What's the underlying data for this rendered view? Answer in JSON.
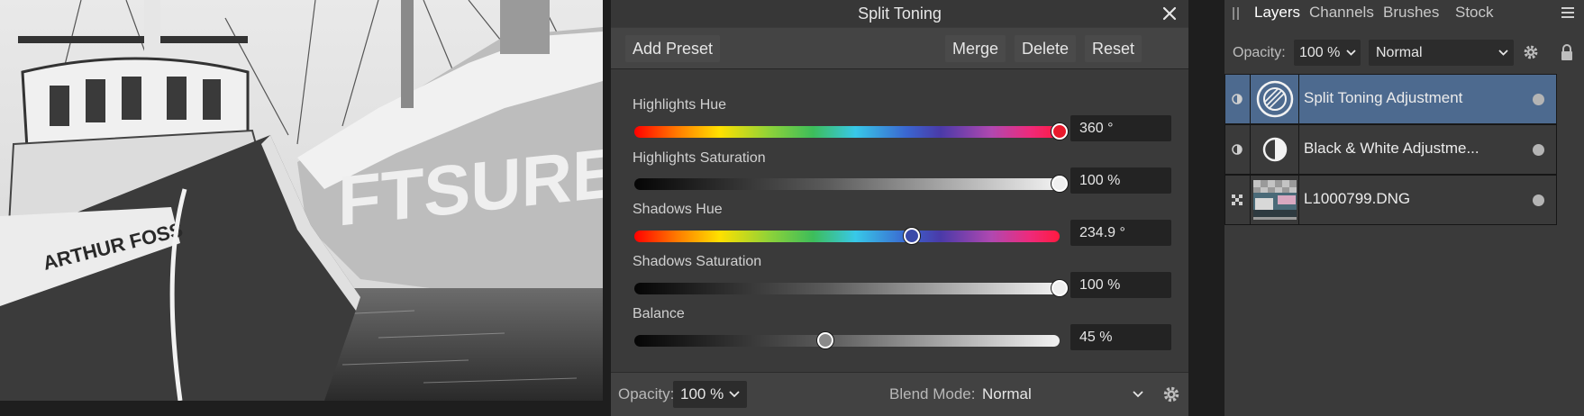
{
  "dialog": {
    "title": "Split Toning",
    "toolbar": {
      "add_preset": "Add Preset",
      "merge": "Merge",
      "delete": "Delete",
      "reset": "Reset"
    },
    "sliders": [
      {
        "label": "Highlights Hue",
        "value": "360 °",
        "position": 1.0,
        "knob_color": "#e8192c"
      },
      {
        "label": "Highlights Saturation",
        "value": "100 %",
        "position": 1.0,
        "knob_color": "#f0f0f0"
      },
      {
        "label": "Shadows Hue",
        "value": "234.9 °",
        "position": 0.652,
        "knob_color": "#3a4aa8"
      },
      {
        "label": "Shadows Saturation",
        "value": "100 %",
        "position": 1.0,
        "knob_color": "#f0f0f0"
      },
      {
        "label": "Balance",
        "value": "45 %",
        "position": 0.45,
        "knob_color": "#8a8a8a"
      }
    ],
    "footer": {
      "opacity_label": "Opacity:",
      "opacity_value": "100 %",
      "blend_label": "Blend Mode:",
      "blend_value": "Normal"
    }
  },
  "layers_panel": {
    "tabs": [
      "Layers",
      "Channels",
      "Brushes",
      "Stock"
    ],
    "active_tab": "Layers",
    "opacity_label": "Opacity:",
    "opacity_value": "100 %",
    "blend_value": "Normal",
    "layers": [
      {
        "name": "Split Toning Adjustment",
        "selected": true,
        "icon": "split-toning-icon"
      },
      {
        "name": "Black & White Adjustme...",
        "selected": false,
        "icon": "black-white-icon"
      },
      {
        "name": "L1000799.DNG",
        "selected": false,
        "icon": "image-thumbnail"
      }
    ]
  },
  "photo": {
    "hull_text_1": "ARTHUR FOSS",
    "hull_text_2": "FTSURE"
  },
  "colors": {
    "selected_layer": "#4d6a8f",
    "panel_bg": "#3a3a3a",
    "app_bg": "#1e1e1e"
  }
}
